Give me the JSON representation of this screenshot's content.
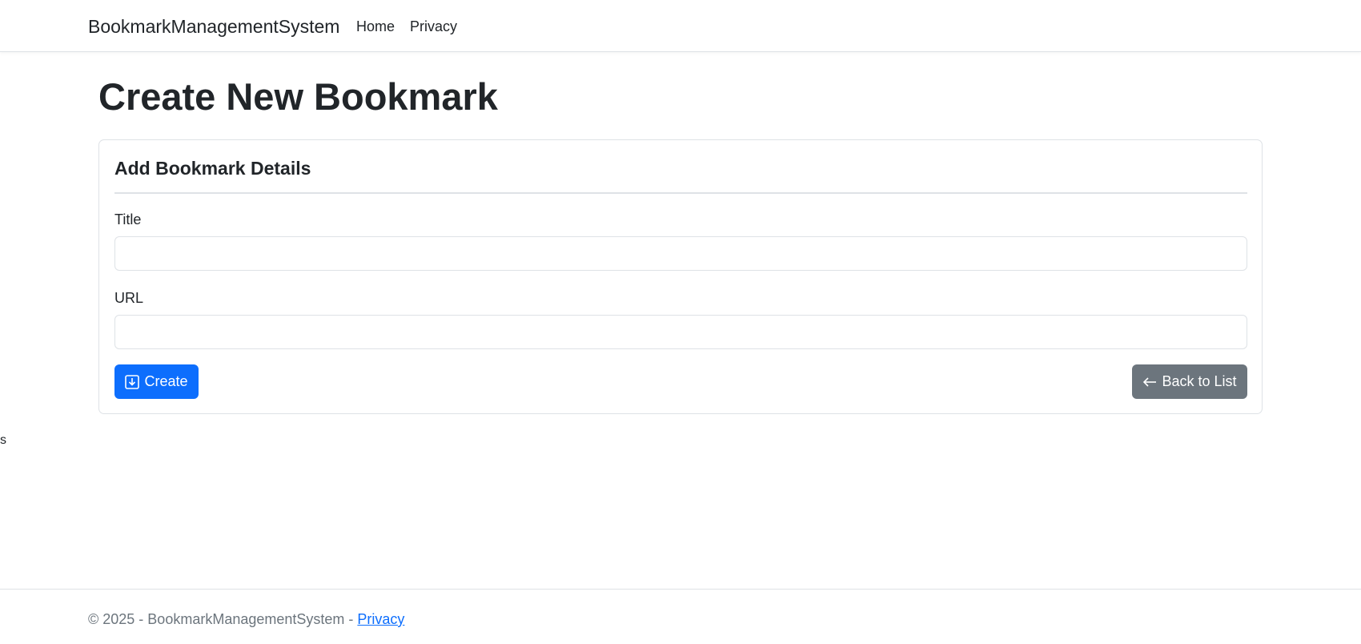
{
  "navbar": {
    "brand": "BookmarkManagementSystem",
    "links": [
      {
        "label": "Home"
      },
      {
        "label": "Privacy"
      }
    ]
  },
  "page": {
    "title": "Create New Bookmark"
  },
  "card": {
    "title": "Add Bookmark Details",
    "fields": {
      "title": {
        "label": "Title",
        "value": "",
        "placeholder": ""
      },
      "url": {
        "label": "URL",
        "value": "",
        "placeholder": ""
      }
    },
    "create_button": {
      "label": "Create",
      "icon": "download-box-icon"
    },
    "back_button": {
      "label": "Back to List",
      "icon": "arrow-left-icon"
    }
  },
  "stray_text": "s",
  "footer": {
    "text": "© 2025 - BookmarkManagementSystem - ",
    "link_label": "Privacy"
  },
  "colors": {
    "primary": "#0d6efd",
    "secondary": "#6c757d",
    "border": "#dee2e6",
    "text": "#212529"
  }
}
